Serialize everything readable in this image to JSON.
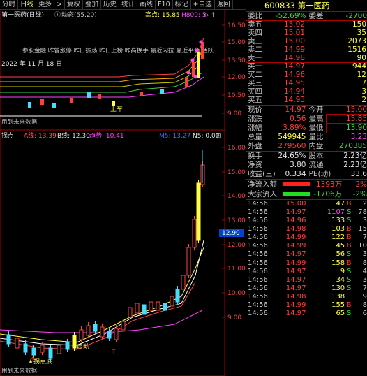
{
  "menubar": {
    "items": [
      "分时",
      "日线",
      "更多",
      ">",
      "复权",
      "叠加",
      "历史",
      "统计",
      "画线",
      "F10",
      "标记",
      "+自选",
      "返回"
    ],
    "active_index": 1
  },
  "main_chart": {
    "title": "第一医药(日线)",
    "info_icon": "ⓘ",
    "indicator": "动态(55,20)",
    "high_label": "高点: 15.85",
    "h809_label": "H809: 5",
    "nav_glyphs": "◇ ↑",
    "hint_text": "参股金融  昨曾涨停  昨日振荡  昨日上榜  昨高换手  最近闪拉  最近平台  活跃",
    "date_text": "2022 年 11 月 18 日",
    "tag_label": "上车",
    "future_label": "用到未来数据",
    "y_labels": [
      "16.50",
      "15.00",
      "13.50",
      "12.00",
      "10.50",
      "9.00"
    ]
  },
  "sub_chart": {
    "name_label": "拐点",
    "a_label": "A线: 13.39",
    "b_label": "B线: 12.30",
    "trend_label": "趋势: 10.41",
    "m5_label": "M5: 13.27",
    "n5_label": "N5: 0.00",
    "lock_icon": "⊟",
    "y_labels": [
      "16.00",
      "15.00",
      "14.00",
      "13.00",
      "12.00",
      "11.00",
      "10.00",
      "9.00"
    ],
    "current_tag": "12.90",
    "launch_label": "启动",
    "turn_label": "★拐点底",
    "future_label": "用到未来数据"
  },
  "quote": {
    "code_name": "600833 第一医药",
    "wb_label": "委比",
    "wb_value": "-52.69%",
    "wc_label": "委差",
    "wc_value": "-2700",
    "asks": [
      {
        "label": "卖五",
        "price": "15.02",
        "vol": "150"
      },
      {
        "label": "卖四",
        "price": "15.01",
        "vol": "35"
      },
      {
        "label": "卖三",
        "price": "15.00",
        "vol": "2073"
      },
      {
        "label": "卖二",
        "price": "14.99",
        "vol": "1516"
      },
      {
        "label": "卖一",
        "price": "14.98",
        "vol": "90"
      }
    ],
    "bids": [
      {
        "label": "买一",
        "price": "14.97",
        "vol": "944"
      },
      {
        "label": "买二",
        "price": "14.96",
        "vol": "12"
      },
      {
        "label": "买三",
        "price": "14.95",
        "vol": "7"
      },
      {
        "label": "买四",
        "price": "14.94",
        "vol": "3"
      },
      {
        "label": "买五",
        "price": "14.93",
        "vol": "2"
      }
    ],
    "stats": [
      {
        "l1": "现价",
        "v1": "14.97",
        "c1": "red",
        "l2": "今开",
        "v2": "15.00",
        "c2": "red"
      },
      {
        "l1": "涨跌",
        "v1": "0.56",
        "c1": "red",
        "l2": "最高",
        "v2": "15.85",
        "c2": "red",
        "box2": true
      },
      {
        "l1": "涨幅",
        "v1": "3.89%",
        "c1": "red",
        "l2": "最低",
        "v2": "13.90",
        "c2": "green",
        "box2": true
      },
      {
        "l1": "总量",
        "v1": "549945",
        "c1": "yellow",
        "l2": "量比",
        "v2": "3.23",
        "c2": "magenta"
      },
      {
        "l1": "外盘",
        "v1": "279560",
        "c1": "red",
        "l2": "内盘",
        "v2": "270385",
        "c2": "green"
      }
    ],
    "stats2": [
      {
        "l1": "换手",
        "v1": "24.65%",
        "c1": "white",
        "l2": "股本",
        "v2": "2.23亿",
        "c2": "white"
      },
      {
        "l1": "净资",
        "v1": "3.80",
        "c1": "white",
        "l2": "流通",
        "v2": "2.23亿",
        "c2": "white"
      },
      {
        "l1": "收益(三)",
        "v1": "0.334",
        "c1": "white",
        "l2": "PE(动)",
        "v2": "33.6",
        "c2": "white"
      }
    ],
    "flows": [
      {
        "label": "净流入额",
        "bar_color": "#ff2222",
        "value": "1393万",
        "pct": "2%",
        "color": "red"
      },
      {
        "label": "大宗流入",
        "bar_color": "#22dd22",
        "value": "-1706万",
        "pct": "-2%",
        "color": "green"
      }
    ],
    "ticks": [
      {
        "t": "14:56",
        "p": "15.00",
        "pc": "red",
        "v": "47",
        "vc": "yellow",
        "d": "B",
        "dc": "red",
        "n": "2"
      },
      {
        "t": "14:56",
        "p": "14.97",
        "pc": "red",
        "v": "1107",
        "vc": "magenta",
        "d": "S",
        "dc": "green",
        "n": "78"
      },
      {
        "t": "14:56",
        "p": "14.96",
        "pc": "red",
        "v": "133",
        "vc": "yellow",
        "d": "S",
        "dc": "green",
        "n": "3"
      },
      {
        "t": "14:56",
        "p": "14.98",
        "pc": "red",
        "v": "103",
        "vc": "yellow",
        "d": "B",
        "dc": "red",
        "n": "15"
      },
      {
        "t": "14:56",
        "p": "14.99",
        "pc": "red",
        "v": "122",
        "vc": "yellow",
        "d": "B",
        "dc": "red",
        "n": "7"
      },
      {
        "t": "14:56",
        "p": "14.99",
        "pc": "red",
        "v": "45",
        "vc": "yellow",
        "d": "B",
        "dc": "red",
        "n": "10"
      },
      {
        "t": "14:56",
        "p": "14.97",
        "pc": "red",
        "v": "56",
        "vc": "yellow",
        "d": "S",
        "dc": "green",
        "n": "3"
      },
      {
        "t": "14:56",
        "p": "14.99",
        "pc": "red",
        "v": "158",
        "vc": "yellow",
        "d": "B",
        "dc": "red",
        "n": "8"
      },
      {
        "t": "14:56",
        "p": "14.97",
        "pc": "red",
        "v": "9",
        "vc": "yellow",
        "d": "S",
        "dc": "green",
        "n": "4"
      },
      {
        "t": "14:56",
        "p": "14.97",
        "pc": "red",
        "v": "34",
        "vc": "yellow",
        "d": "S",
        "dc": "green",
        "n": "3"
      },
      {
        "t": "14:56",
        "p": "14.97",
        "pc": "red",
        "v": "130",
        "vc": "yellow",
        "d": "S",
        "dc": "green",
        "n": "7"
      },
      {
        "t": "14:56",
        "p": "14.98",
        "pc": "red",
        "v": "138",
        "vc": "yellow",
        "d": "",
        "dc": "red",
        "n": "9"
      },
      {
        "t": "14:56",
        "p": "14.99",
        "pc": "red",
        "v": "155",
        "vc": "yellow",
        "d": "B",
        "dc": "red",
        "n": "8"
      },
      {
        "t": "14:56",
        "p": "14.97",
        "pc": "red",
        "v": "65",
        "vc": "yellow",
        "d": "S",
        "dc": "green",
        "n": "6"
      }
    ]
  }
}
